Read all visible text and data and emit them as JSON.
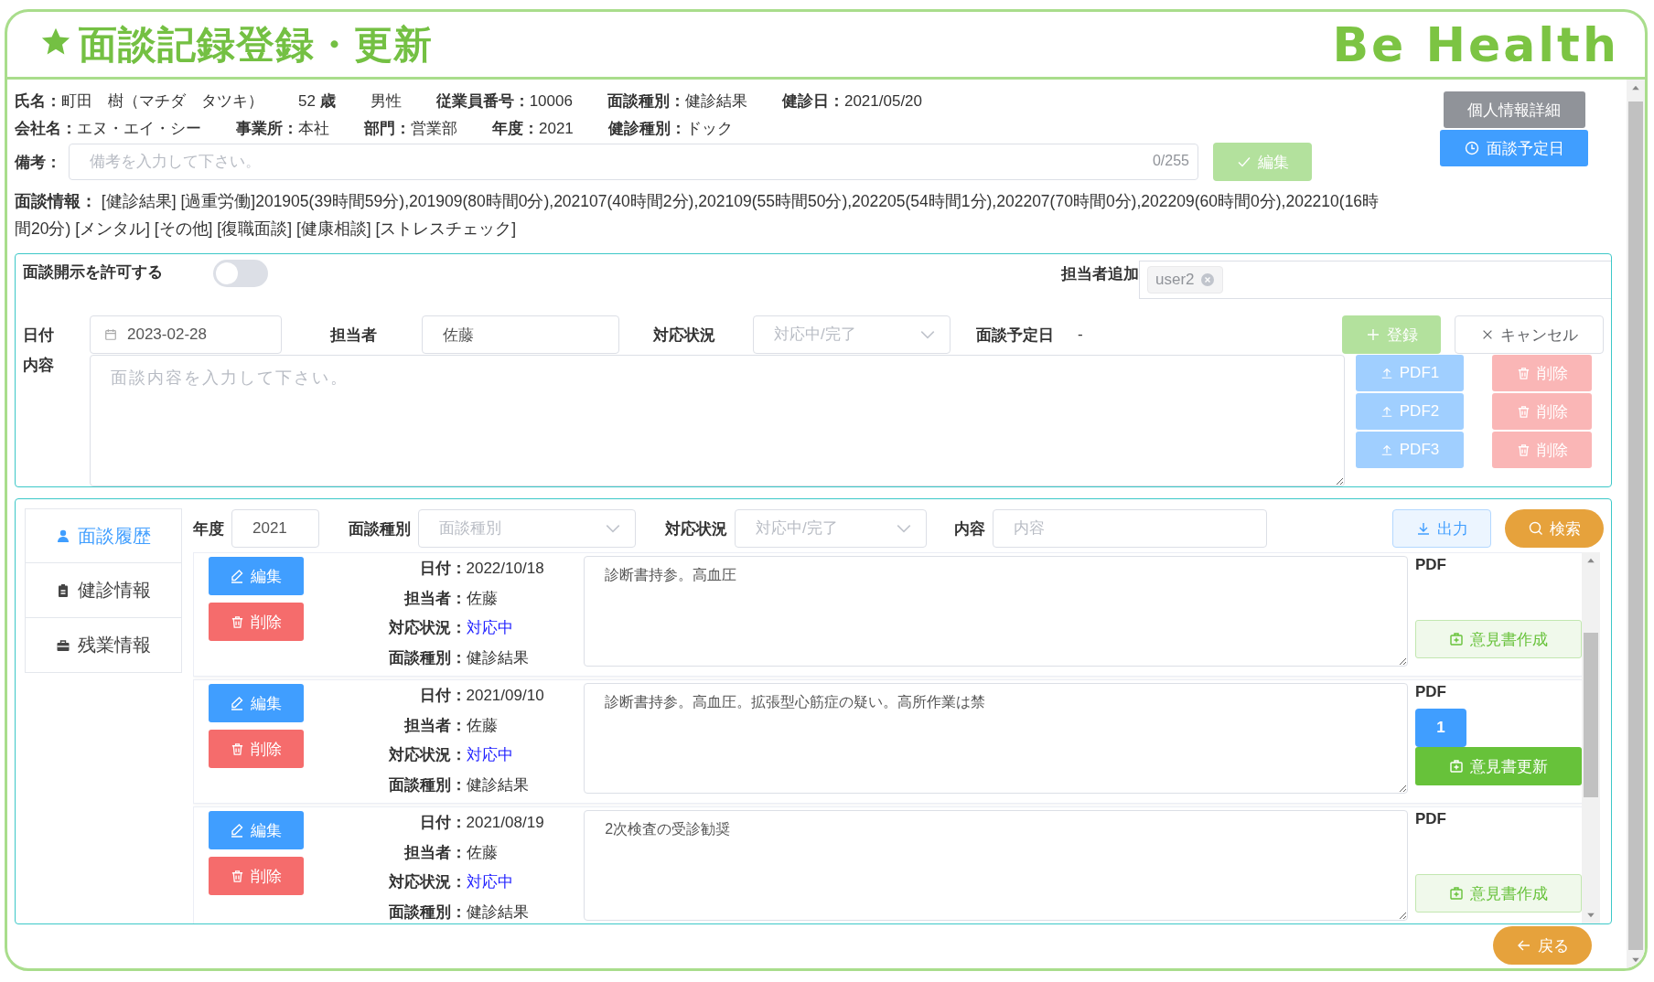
{
  "header": {
    "title": "面談記録登録・更新",
    "logo": "Be Health"
  },
  "employee": {
    "rows": [
      [
        {
          "label": "氏名：",
          "value": "町田　樹（マチダ　タツキ）"
        },
        {
          "value": "52",
          "suffix": "歳"
        },
        {
          "value": "男性"
        },
        {
          "label": "従業員番号：",
          "value": "10006"
        },
        {
          "label": "面談種別：",
          "value": "健診結果"
        },
        {
          "label": "健診日：",
          "value": "2021/05/20"
        }
      ],
      [
        {
          "label": "会社名：",
          "value": "エヌ・エイ・シー"
        },
        {
          "label": "事業所：",
          "value": "本社"
        },
        {
          "label": "部門：",
          "value": "営業部"
        },
        {
          "label": "年度：",
          "value": "2021"
        },
        {
          "label": "健診種別：",
          "value": "ドック"
        }
      ]
    ],
    "remark": {
      "label": "備考：",
      "placeholder": "備考を入力して下さい。",
      "counter": "0/255",
      "button": {
        "label": "編集",
        "disabled": true
      }
    },
    "side_buttons": [
      {
        "label": "個人情報詳細",
        "kind": "plain"
      },
      {
        "label": "面談予定日",
        "kind": "schedule"
      }
    ],
    "interview_info": {
      "text": "**面談情報：** [健診結果] [過重労働]201905(39時間59分),201909(80時間0分),202107(40時間2分),202109(55時間50分),202205(54時間1分),202207(70時間0分),202209(60時間0分),202210(16時間20分) [メンタル] [その他] [復職面談] [健康相談] [ストレスチェック]"
    }
  },
  "editor": {
    "disclosure": {
      "label": "面談開示を許可する",
      "on": false
    },
    "assignee_add": {
      "label": "担当者追加",
      "tags": [
        "user2"
      ]
    },
    "date": {
      "label": "日付",
      "value": "2023-02-28"
    },
    "person": {
      "label": "担当者",
      "value": "佐藤"
    },
    "status": {
      "label": "対応状況",
      "placeholder": "対応中/完了"
    },
    "scheduled": {
      "label": "面談予定日",
      "value": "-"
    },
    "register_button": {
      "label": "登録",
      "disabled": true
    },
    "cancel_button": {
      "label": "キャンセル"
    },
    "content": {
      "label": "内容",
      "placeholder": "面談内容を入力して下さい。"
    },
    "pdf_rows": [
      {
        "upload": {
          "label": "PDF1",
          "disabled": true
        },
        "delete": {
          "label": "削除",
          "disabled": true
        }
      },
      {
        "upload": {
          "label": "PDF2",
          "disabled": true
        },
        "delete": {
          "label": "削除",
          "disabled": true
        }
      },
      {
        "upload": {
          "label": "PDF3",
          "disabled": true
        },
        "delete": {
          "label": "削除",
          "disabled": true
        }
      }
    ]
  },
  "history": {
    "tabs": [
      {
        "label": "面談履歴",
        "selected": true
      },
      {
        "label": "健診情報",
        "selected": false
      },
      {
        "label": "残業情報",
        "selected": false
      }
    ],
    "filters": {
      "year": {
        "label": "年度",
        "value": "2021"
      },
      "type": {
        "label": "面談種別",
        "placeholder": "面談種別"
      },
      "status": {
        "label": "対応状況",
        "placeholder": "対応中/完了"
      },
      "content": {
        "label": "内容",
        "placeholder": "内容"
      }
    },
    "export_button": "出力",
    "search_button": "検索",
    "records": [
      {
        "edit": "編集",
        "delete": "削除",
        "details": [
          {
            "label": "日付：",
            "value": "2022/10/18"
          },
          {
            "label": "担当者：",
            "value": "佐藤"
          },
          {
            "label": "対応状況：",
            "value": "対応中",
            "kind": "status"
          },
          {
            "label": "面談種別：",
            "value": "健診結果"
          }
        ],
        "content": "診断書持参。高血圧",
        "pdf_label": "PDF",
        "opinion": {
          "label": "意見書作成",
          "kind": "create"
        }
      },
      {
        "edit": "編集",
        "delete": "削除",
        "details": [
          {
            "label": "日付：",
            "value": "2021/09/10"
          },
          {
            "label": "担当者：",
            "value": "佐藤"
          },
          {
            "label": "対応状況：",
            "value": "対応中",
            "kind": "status"
          },
          {
            "label": "面談種別：",
            "value": "健診結果"
          }
        ],
        "content": "診断書持参。高血圧。拡張型心筋症の疑い。高所作業は禁",
        "pdf_label": "PDF",
        "pdfs": [
          "1"
        ],
        "opinion": {
          "label": "意見書更新",
          "kind": "update"
        }
      },
      {
        "edit": "編集",
        "delete": "削除",
        "details": [
          {
            "label": "日付：",
            "value": "2021/08/19"
          },
          {
            "label": "担当者：",
            "value": "佐藤"
          },
          {
            "label": "対応状況：",
            "value": "対応中",
            "kind": "status"
          },
          {
            "label": "面談種別：",
            "value": "健診結果"
          }
        ],
        "content": "2次検査の受診勧奨",
        "pdf_label": "PDF",
        "opinion": {
          "label": "意見書作成",
          "kind": "create"
        }
      }
    ]
  },
  "back_button": "戻る"
}
